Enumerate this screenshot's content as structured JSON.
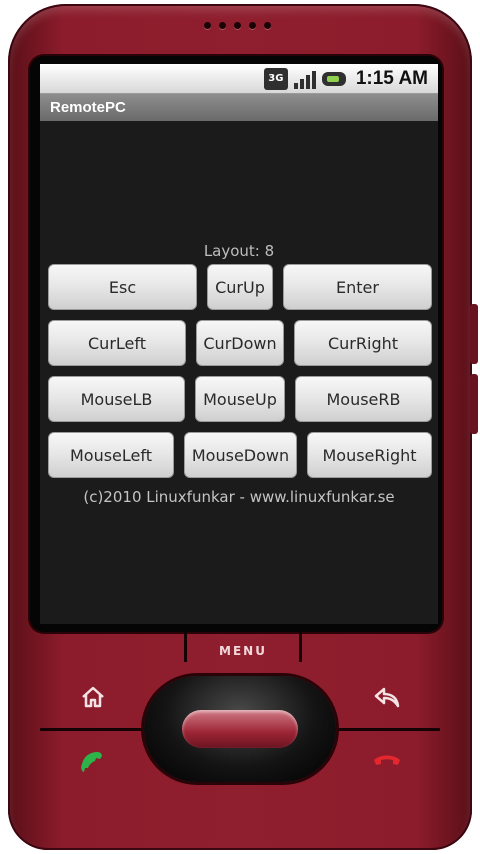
{
  "status_bar": {
    "network_label": "3G",
    "time": "1:15 AM",
    "icons": [
      "network-3g-icon",
      "signal-strength-icon",
      "battery-charging-icon"
    ]
  },
  "app": {
    "title": "RemotePC",
    "layout_label": "Layout: 8",
    "footer": "(c)2010 Linuxfunkar - www.linuxfunkar.se"
  },
  "buttons": {
    "esc": "Esc",
    "cur_up": "CurUp",
    "enter": "Enter",
    "cur_left": "CurLeft",
    "cur_down": "CurDown",
    "cur_right": "CurRight",
    "mouse_lb": "MouseLB",
    "mouse_up": "MouseUp",
    "mouse_rb": "MouseRB",
    "mouse_left": "MouseLeft",
    "mouse_down": "MouseDown",
    "mouse_right": "MouseRight"
  },
  "device": {
    "menu_label": "MENU",
    "hardware_icons": [
      "home-icon",
      "back-icon",
      "call-icon",
      "end-call-icon"
    ],
    "body_color": "#8f1f2e"
  }
}
